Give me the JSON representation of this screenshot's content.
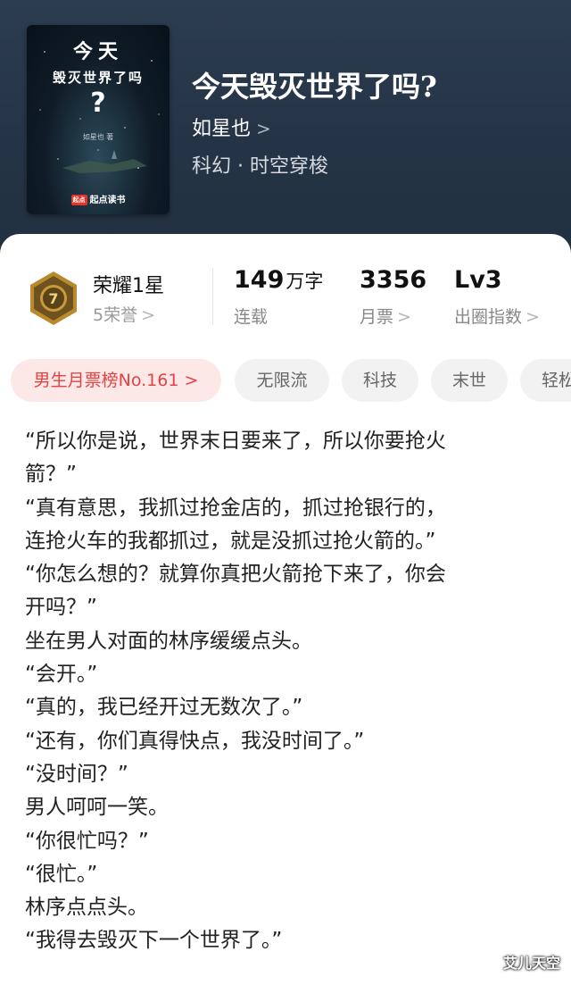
{
  "book": {
    "title": "今天毁灭世界了吗?",
    "author": "如星也",
    "author_chevron": ">",
    "genre": "科幻 · 时空穿梭"
  },
  "cover": {
    "title_line1": "今天",
    "title_line2": "毁灭世界了吗",
    "question_mark": "?",
    "author": "如星也 著",
    "logo_badge": "起点",
    "logo_text": "起点读书"
  },
  "stats": {
    "honor": {
      "title": "荣耀1星",
      "sub": "5荣誉",
      "chevron": ">",
      "icon": "medal-icon"
    },
    "words": {
      "value": "149",
      "unit": "万字",
      "label": "连载"
    },
    "tickets": {
      "value": "3356",
      "label": "月票",
      "chevron": ">"
    },
    "level": {
      "value": "Lv3",
      "label": "出圈指数",
      "chevron": ">"
    }
  },
  "tags": [
    {
      "label": "男生月票榜No.161 >",
      "kind": "rank"
    },
    {
      "label": "无限流",
      "kind": "normal"
    },
    {
      "label": "科技",
      "kind": "normal"
    },
    {
      "label": "末世",
      "kind": "normal"
    },
    {
      "label": "轻松",
      "kind": "normal"
    }
  ],
  "content": {
    "lines": [
      "“所以你是说，世界末日要来了，所以你要抢火",
      "箭？”",
      "“真有意思，我抓过抢金店的，抓过抢银行的，",
      "连抢火车的我都抓过，就是没抓过抢火箭的。”",
      "“你怎么想的？就算你真把火箭抢下来了，你会",
      "开吗？”",
      "坐在男人对面的林序缓缓点头。",
      "“会开。”",
      "“真的，我已经开过无数次了。”",
      "“还有，你们真得快点，我没时间了。”",
      "“没时间？”",
      "男人呵呵一笑。",
      "“你很忙吗？”",
      "“很忙。”",
      "林序点点头。",
      "“我得去毁灭下一个世界了。”"
    ]
  },
  "watermark": "艾儿天空",
  "colors": {
    "header_bg": "#243446",
    "rank_tag_bg": "#fde8e8",
    "rank_tag_text": "#e54242",
    "tag_bg": "#f2f2f2"
  }
}
